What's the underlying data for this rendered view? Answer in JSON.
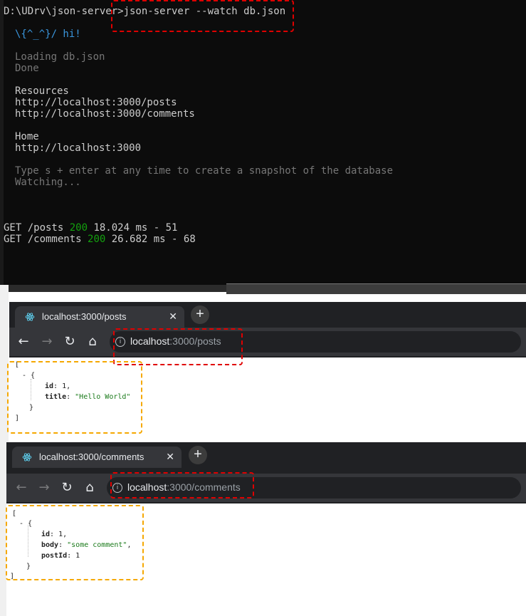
{
  "terminal": {
    "prompt": "D:\\UDrv\\json-server>",
    "command": "json-server --watch db.json",
    "greeting": "\\{^_^}/ hi!",
    "loading": "Loading db.json",
    "done": "Done",
    "resources_heading": "Resources",
    "resource_urls": [
      "http://localhost:3000/posts",
      "http://localhost:3000/comments"
    ],
    "home_heading": "Home",
    "home_url": "http://localhost:3000",
    "snapshot_hint": "Type s + enter at any time to create a snapshot of the database",
    "watching": "Watching...",
    "requests": [
      {
        "method_path": "GET /posts ",
        "status": "200",
        "timing": " 18.024 ms - 51"
      },
      {
        "method_path": "GET /comments ",
        "status": "200",
        "timing": " 26.682 ms - 68"
      }
    ],
    "colors": {
      "background": "#0c0c0c",
      "text": "#cccccc",
      "dim": "#767676",
      "status_ok": "#13a10e",
      "highlight": "#e00000"
    }
  },
  "browser_posts": {
    "tab_title": "localhost:3000/posts",
    "tab_close": "✕",
    "new_tab": "+",
    "url_host": "localhost",
    "url_path": ":3000/posts",
    "json": {
      "open_bracket": "[",
      "collapse": "- {",
      "id_key": "id",
      "id_value": "1",
      "title_key": "title",
      "title_value": "\"Hello World\"",
      "close_brace": "}",
      "close_bracket": "]"
    }
  },
  "browser_comments": {
    "tab_title": "localhost:3000/comments",
    "tab_close": "✕",
    "new_tab": "+",
    "url_host": "localhost",
    "url_path": ":3000/comments",
    "json": {
      "open_bracket": "[",
      "collapse": "- {",
      "id_key": "id",
      "id_value": "1",
      "body_key": "body",
      "body_value": "\"some comment\"",
      "postId_key": "postId",
      "postId_value": "1",
      "close_brace": "}",
      "close_bracket": "]"
    }
  },
  "icons": {
    "back": "arrow-left-icon",
    "forward": "arrow-right-icon",
    "reload": "reload-icon",
    "home": "home-icon",
    "info": "info-icon",
    "tab_favicon": "react-icon"
  },
  "annotation_colors": {
    "red": "#e00000",
    "orange": "#f5a800"
  }
}
